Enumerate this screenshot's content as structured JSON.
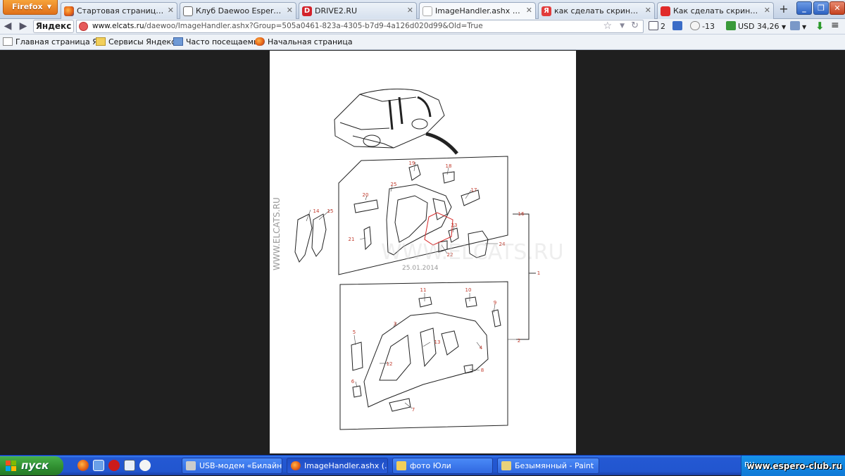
{
  "browser": {
    "menu_button": "Firefox",
    "tabs": [
      {
        "label": "Стартовая страница Fire...",
        "active": false
      },
      {
        "label": "Клуб Daewoo Espero||Ку...",
        "active": false
      },
      {
        "label": "DRIVE2.RU",
        "active": false
      },
      {
        "label": "ImageHandler.ashx (Изоб...",
        "active": true
      },
      {
        "label": "как сделать скриншот э...",
        "active": false
      },
      {
        "label": "Как сделать скриншот ...",
        "active": false
      }
    ],
    "new_tab": "+",
    "search_logo": "Яндекс",
    "url_domain": "www.elcats.ru",
    "url_path": "/daewoo/ImageHandler.ashx?Group=505a0461-823a-4305-b7d9-4a126d020d99&Old=True",
    "mail_count": "2",
    "weather": "-13",
    "currency": "USD 34,26"
  },
  "bookmarks": [
    {
      "label": "Главная страница Я..."
    },
    {
      "label": "Сервисы Яндекса"
    },
    {
      "label": "Часто посещаемые"
    },
    {
      "label": "Начальная страница"
    }
  ],
  "diagram": {
    "watermark_side": "WWW.ELCATS.RU",
    "watermark_center": "WWW.ELCATS.RU",
    "date": "25.01.2014",
    "callouts": [
      "1",
      "2",
      "3",
      "4",
      "5",
      "6",
      "7",
      "8",
      "9",
      "10",
      "11",
      "12",
      "13",
      "14",
      "15",
      "16",
      "17",
      "18",
      "19",
      "20",
      "21",
      "22",
      "23",
      "24",
      "25"
    ]
  },
  "taskbar": {
    "start": "пуск",
    "tasks": [
      {
        "label": "USB-модем «Билайн»"
      },
      {
        "label": "ImageHandler.ashx (..."
      },
      {
        "label": "фото Юли"
      },
      {
        "label": "Безымянный - Paint"
      }
    ],
    "tray_lang": "RU",
    "site_watermark": "www.espero-club.ru"
  }
}
